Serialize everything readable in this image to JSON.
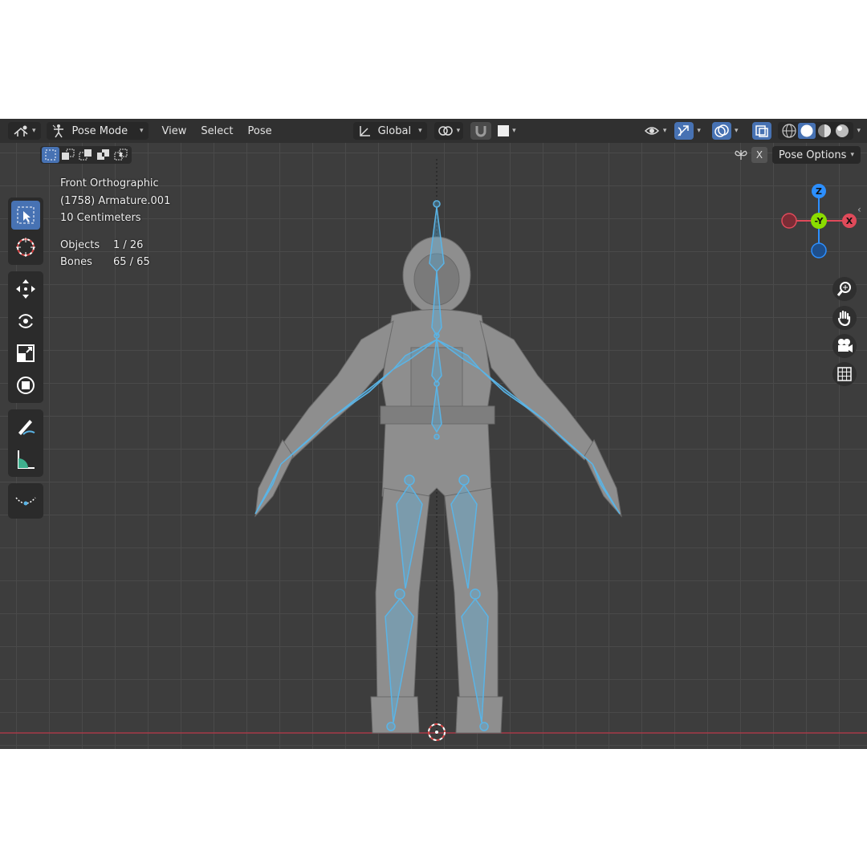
{
  "header": {
    "mode": "Pose Mode",
    "menus": [
      "View",
      "Select",
      "Pose"
    ],
    "orientation": "Global"
  },
  "toolsettings": {
    "pose_options": "Pose Options",
    "x_mirror": "X"
  },
  "viewport_info": {
    "view": "Front Orthographic",
    "object": "(1758) Armature.001",
    "scale": "10 Centimeters",
    "stats": [
      {
        "label": "Objects",
        "value": "1 / 26"
      },
      {
        "label": "Bones",
        "value": "65 / 65"
      }
    ]
  },
  "gizmo": {
    "z": "Z",
    "neg_y": "-Y",
    "x": "X"
  },
  "colors": {
    "accent": "#4772b3",
    "bone": "#5ab4e6",
    "axis_x": "#e04a5a",
    "axis_y": "#8bdc00",
    "axis_z": "#2c8fff"
  },
  "icons": {
    "toolbar": [
      "select-box-icon",
      "cursor-icon",
      "move-icon",
      "rotate-icon",
      "scale-icon",
      "transform-icon",
      "annotate-icon",
      "measure-icon",
      "relax-pose-icon"
    ],
    "nav": [
      "zoom-icon",
      "pan-hand-icon",
      "camera-icon",
      "grid-perspective-icon"
    ]
  }
}
